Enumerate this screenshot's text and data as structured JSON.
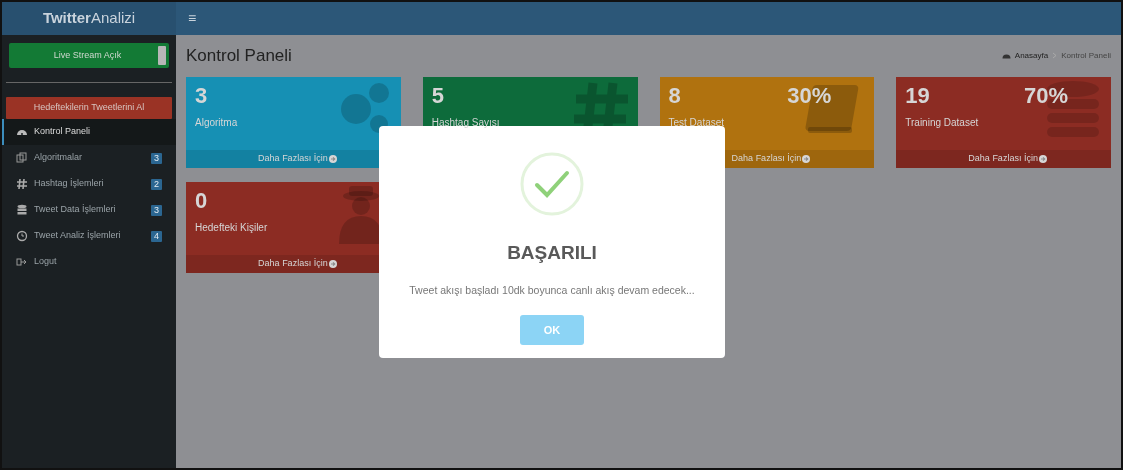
{
  "brand": {
    "bold": "Twitter",
    "light": "Analizi"
  },
  "header": {
    "menu_glyph": "≡"
  },
  "sidebar": {
    "live_stream": {
      "label": "Live Stream Açık",
      "on": true
    },
    "action_button": "Hedeftekilerin Tweetlerini Al",
    "items": [
      {
        "label": "Kontrol Paneli",
        "selected": true
      },
      {
        "label": "Algoritmalar",
        "badge": "3",
        "selected": false
      },
      {
        "label": "Hashtag İşlemleri",
        "badge": "2",
        "selected": false
      },
      {
        "label": "Tweet Data İşlemleri",
        "badge": "3",
        "selected": false
      },
      {
        "label": "Tweet Analiz İşlemleri",
        "badge": "4",
        "selected": false
      },
      {
        "label": "Logut",
        "selected": false
      }
    ]
  },
  "page": {
    "title": "Kontrol Paneli",
    "breadcrumb": [
      "Anasayfa",
      "Kontrol Paneli"
    ]
  },
  "cards": [
    {
      "value": "3",
      "label": "Algoritma",
      "footer": "Daha Fazlası İçin",
      "color": "#1690b4"
    },
    {
      "value": "5",
      "label": "Hashtag Sayısı",
      "color": "#0d6b3b"
    },
    {
      "value": "8",
      "percent": "30%",
      "label": "Test Dataset",
      "footer": "Daha Fazlası İçin",
      "color": "#b0720f"
    },
    {
      "value": "19",
      "percent": "70%",
      "label": "Training Dataset",
      "footer": "Daha Fazlası İçin",
      "color": "#8c2c23"
    },
    {
      "value": "0",
      "label": "Hedefteki Kişiler",
      "footer": "Daha Fazlası İçin",
      "color": "#8c2c23"
    }
  ],
  "modal": {
    "title": "BAŞARILI",
    "message": "Tweet akışı başladı 10dk boyunca canlı akış devam edecek...",
    "button": "OK"
  }
}
